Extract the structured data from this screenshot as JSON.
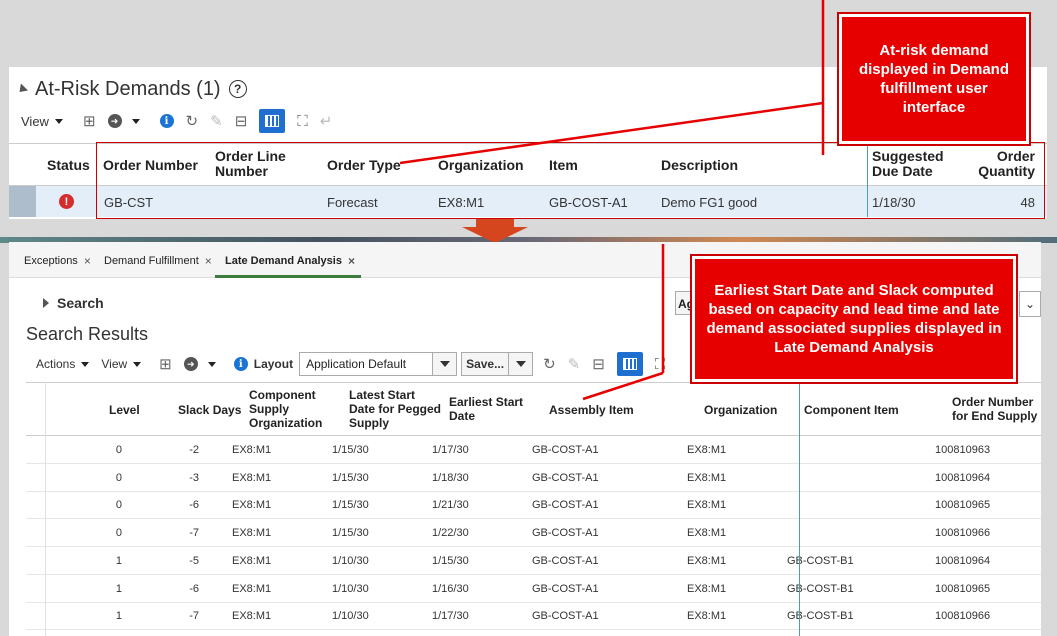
{
  "top": {
    "title": "At-Risk Demands (1)",
    "toolbar": {
      "view_label": "View"
    },
    "columns": {
      "status": "Status",
      "order_number": "Order Number",
      "order_line_1": "Order Line",
      "order_line_2": "Number",
      "order_type": "Order Type",
      "organization": "Organization",
      "item": "Item",
      "description": "Description",
      "suggested_1": "Suggested",
      "suggested_2": "Due Date",
      "quantity_1": "Order",
      "quantity_2": "Quantity"
    },
    "row": {
      "order_number": "GB-CST",
      "order_type": "Forecast",
      "organization": "EX8:M1",
      "item": "GB-COST-A1",
      "description": "Demo FG1 good",
      "suggested_due_date": "1/18/30",
      "order_quantity": "48"
    }
  },
  "callouts": {
    "top": "At-risk demand displayed in Demand fulfillment user interface",
    "bottom": "Earliest Start Date and Slack computed based on capacity and lead time and late demand associated supplies displayed in Late Demand Analysis"
  },
  "tabs": [
    {
      "label": "Exceptions"
    },
    {
      "label": "Demand Fulfillment"
    },
    {
      "label": "Late Demand Analysis"
    }
  ],
  "bottom": {
    "search_label": "Search",
    "results_title": "Search Results",
    "ag_text": "Ag",
    "toolbar": {
      "actions_label": "Actions",
      "view_label": "View",
      "layout_label": "Layout",
      "layout_value": "Application Default",
      "save_label": "Save..."
    },
    "columns": {
      "level": "Level",
      "slack": "Slack Days",
      "comp_org_1": "Component",
      "comp_org_2": "Supply",
      "comp_org_3": "Organization",
      "latest_1": "Latest Start",
      "latest_2": "Date for Pegged",
      "latest_3": "Supply",
      "earliest_1": "Earliest Start",
      "earliest_2": "Date",
      "assembly": "Assembly Item",
      "organization": "Organization",
      "component_item": "Component Item",
      "order_end_1": "Order Number",
      "order_end_2": "for End Supply"
    },
    "rows": [
      {
        "level": "0",
        "slack": "-2",
        "org": "EX8:M1",
        "latest": "1/15/30",
        "earliest": "1/17/30",
        "assembly": "GB-COST-A1",
        "organization": "EX8:M1",
        "component": "",
        "order": "100810963"
      },
      {
        "level": "0",
        "slack": "-3",
        "org": "EX8:M1",
        "latest": "1/15/30",
        "earliest": "1/18/30",
        "assembly": "GB-COST-A1",
        "organization": "EX8:M1",
        "component": "",
        "order": "100810964"
      },
      {
        "level": "0",
        "slack": "-6",
        "org": "EX8:M1",
        "latest": "1/15/30",
        "earliest": "1/21/30",
        "assembly": "GB-COST-A1",
        "organization": "EX8:M1",
        "component": "",
        "order": "100810965"
      },
      {
        "level": "0",
        "slack": "-7",
        "org": "EX8:M1",
        "latest": "1/15/30",
        "earliest": "1/22/30",
        "assembly": "GB-COST-A1",
        "organization": "EX8:M1",
        "component": "",
        "order": "100810966"
      },
      {
        "level": "1",
        "slack": "-5",
        "org": "EX8:M1",
        "latest": "1/10/30",
        "earliest": "1/15/30",
        "assembly": "GB-COST-A1",
        "organization": "EX8:M1",
        "component": "GB-COST-B1",
        "order": "100810964"
      },
      {
        "level": "1",
        "slack": "-6",
        "org": "EX8:M1",
        "latest": "1/10/30",
        "earliest": "1/16/30",
        "assembly": "GB-COST-A1",
        "organization": "EX8:M1",
        "component": "GB-COST-B1",
        "order": "100810965"
      },
      {
        "level": "1",
        "slack": "-7",
        "org": "EX8:M1",
        "latest": "1/10/30",
        "earliest": "1/17/30",
        "assembly": "GB-COST-A1",
        "organization": "EX8:M1",
        "component": "GB-COST-B1",
        "order": "100810966"
      }
    ]
  },
  "colors": {
    "callout_red": "#e60000",
    "accent_blue": "#1f6fd1",
    "tab_underline": "#3d7c3d"
  }
}
